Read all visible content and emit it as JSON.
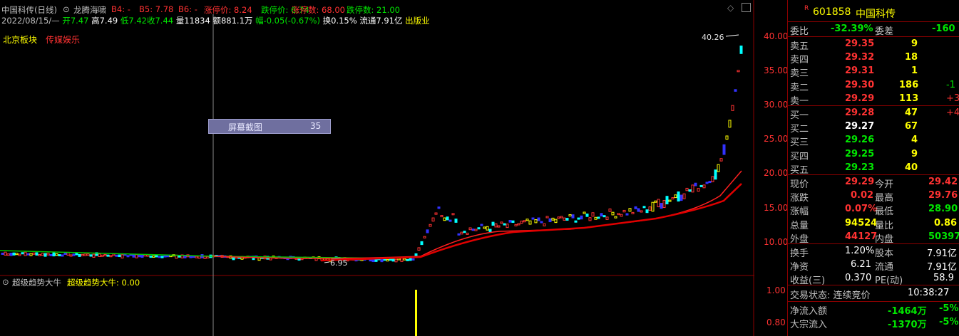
{
  "header": {
    "stock_name": "中国科传",
    "period": "(日线)",
    "indicator_name": "龙腾海啸",
    "b4": "B4: -",
    "b5": "B5: 7.78",
    "b6": "B6: -",
    "limit_up_price": "涨停价: 8.24",
    "limit_down_price": "跌停价: 6.74",
    "limit_up_count": "涨停数: 68.00",
    "limit_down_count": "跌停数: 21.00"
  },
  "quote_line": {
    "date": "2022/08/15/—",
    "open": "开7.47",
    "high": "高7.49",
    "low": "低7.42",
    "close": "收7.44",
    "volume": "量11834",
    "amount": "额881.1万",
    "change": "幅-0.05(-0.67%)",
    "turnover": "换0.15%",
    "float_cap": "流通7.91亿",
    "industry": "出版业"
  },
  "tags": {
    "region": "北京板块",
    "sector": "传媒娱乐"
  },
  "annotations": {
    "high_mark": "40.26",
    "low_mark": "6.95",
    "screenshot_label": "屏幕截图",
    "screenshot_value": "35"
  },
  "y_axis_main": [
    "40.00",
    "35.00",
    "30.00",
    "25.00",
    "20.00",
    "15.00",
    "10.00"
  ],
  "y_axis_sub": [
    "1.00",
    "0.80"
  ],
  "sub_indicator": {
    "name": "超级趋势大牛",
    "label": "超级趋势大牛: 0.00"
  },
  "quote_panel": {
    "code": "601858",
    "name": "中国科传",
    "r_badge": "R",
    "weibi_label": "委比",
    "weibi_value": "-32.39%",
    "weicha_label": "委差",
    "weicha_value": "-160",
    "asks": [
      {
        "label": "卖五",
        "price": "29.35",
        "vol": "9",
        "chg": ""
      },
      {
        "label": "卖四",
        "price": "29.32",
        "vol": "18",
        "chg": ""
      },
      {
        "label": "卖三",
        "price": "29.31",
        "vol": "1",
        "chg": ""
      },
      {
        "label": "卖二",
        "price": "29.30",
        "vol": "186",
        "chg": "-1"
      },
      {
        "label": "卖一",
        "price": "29.29",
        "vol": "113",
        "chg": "+3"
      }
    ],
    "bids": [
      {
        "label": "买一",
        "price": "29.28",
        "vol": "47",
        "chg": "+4"
      },
      {
        "label": "买二",
        "price": "29.27",
        "vol": "67",
        "chg": ""
      },
      {
        "label": "买三",
        "price": "29.26",
        "vol": "4",
        "chg": ""
      },
      {
        "label": "买四",
        "price": "29.25",
        "vol": "9",
        "chg": ""
      },
      {
        "label": "买五",
        "price": "29.23",
        "vol": "40",
        "chg": ""
      }
    ],
    "stats": [
      {
        "l1": "现价",
        "v1": "29.29",
        "l2": "今开",
        "v2": "29.42"
      },
      {
        "l1": "涨跌",
        "v1": "0.02",
        "l2": "最高",
        "v2": "29.76"
      },
      {
        "l1": "涨幅",
        "v1": "0.07%",
        "l2": "最低",
        "v2": "28.90"
      },
      {
        "l1": "总量",
        "v1": "94524",
        "l2": "量比",
        "v2": "0.86"
      },
      {
        "l1": "外盘",
        "v1": "44127",
        "l2": "内盘",
        "v2": "50397"
      }
    ],
    "fund": [
      {
        "l1": "换手",
        "v1": "1.20%",
        "l2": "股本",
        "v2": "7.91亿"
      },
      {
        "l1": "净资",
        "v1": "6.21",
        "l2": "流通",
        "v2": "7.91亿"
      },
      {
        "l1": "收益(三)",
        "v1": "0.370",
        "l2": "PE(动)",
        "v2": "58.9"
      }
    ],
    "trade_status": "交易状态: 连续竞价",
    "trade_time": "10:38:27",
    "netflow": {
      "label": "净流入额",
      "value": "-1464万",
      "pct": "-5%"
    },
    "bigflow": {
      "label": "大宗流入",
      "value": "-1370万",
      "pct": "-5%"
    }
  }
}
